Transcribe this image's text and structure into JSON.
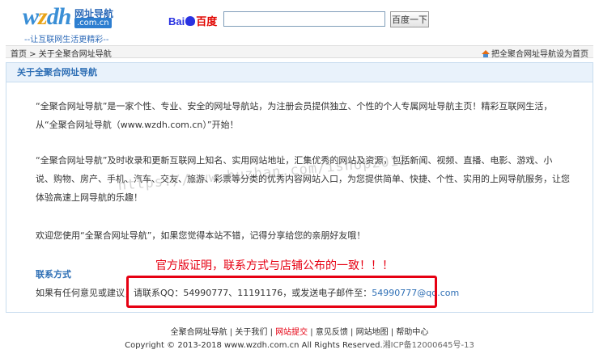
{
  "header": {
    "logo_text_left": "w",
    "logo_text_z": "z",
    "logo_text_right": "dh",
    "logo_cn": "网址导航",
    "logo_domain": ".com.cn",
    "logo_slogan": "--让互联网生活更精彩--",
    "baidu_logo_left": "Bai",
    "baidu_logo_right": "百度",
    "search_value": "",
    "search_button": "百度一下"
  },
  "navbar": {
    "home": "首页",
    "separator": " > ",
    "current": "关于全聚合网址导航",
    "set_home": "把全聚合网址导航设为首页"
  },
  "panel": {
    "title": "关于全聚合网址导航",
    "paragraph1": "“全聚合网址导航”是一家个性、专业、安全的网址导航站，为注册会员提供独立、个性的个人专属网址导航主页！精彩互联网生活，从“全聚合网址导航（www.wzdh.com.cn）”开始！",
    "paragraph2": "“全聚合网址导航”及时收录和更新互联网上知名、实用网站地址，汇集优秀的网站及资源，包括新闻、视频、直播、电影、游戏、小说、购物、房产、手机、汽车、交友、旅游、彩票等分类的优秀内容网站入口，为您提供简单、快捷、个性、实用的上网导航服务，让您体验高速上网导航的乐趣！",
    "paragraph3": "欢迎您使用“全聚合网址导航”，如果您觉得本站不错，记得分享给您的亲朋好友哦！",
    "contact_title": "联系方式",
    "contact_prefix": "如果有任何意见或建议，请联系QQ：54990777、11191176，或发送电子邮件至：",
    "contact_email": "54990777@qq.com"
  },
  "overlay": {
    "watermark": "https://www.huzhan.com/ishop2012",
    "red_note": "官方版证明，联系方式与店铺公布的一致！！！"
  },
  "footer": {
    "link_about_site": "全聚合网址导航",
    "link_about_us": "关于我们",
    "link_submit": "网站提交",
    "link_feedback": "意见反馈",
    "link_sitemap": "网站地图",
    "link_help": "帮助中心",
    "divider": " | ",
    "copyright": "Copyright © 2013-2018 www.wzdh.com.cn All Rights Reserved.",
    "icp": "湘ICP备12000645号-13"
  },
  "colors": {
    "accent_blue": "#2e6fb5",
    "highlight_red": "#e60012",
    "panel_header_bg": "#e9f2fb"
  }
}
